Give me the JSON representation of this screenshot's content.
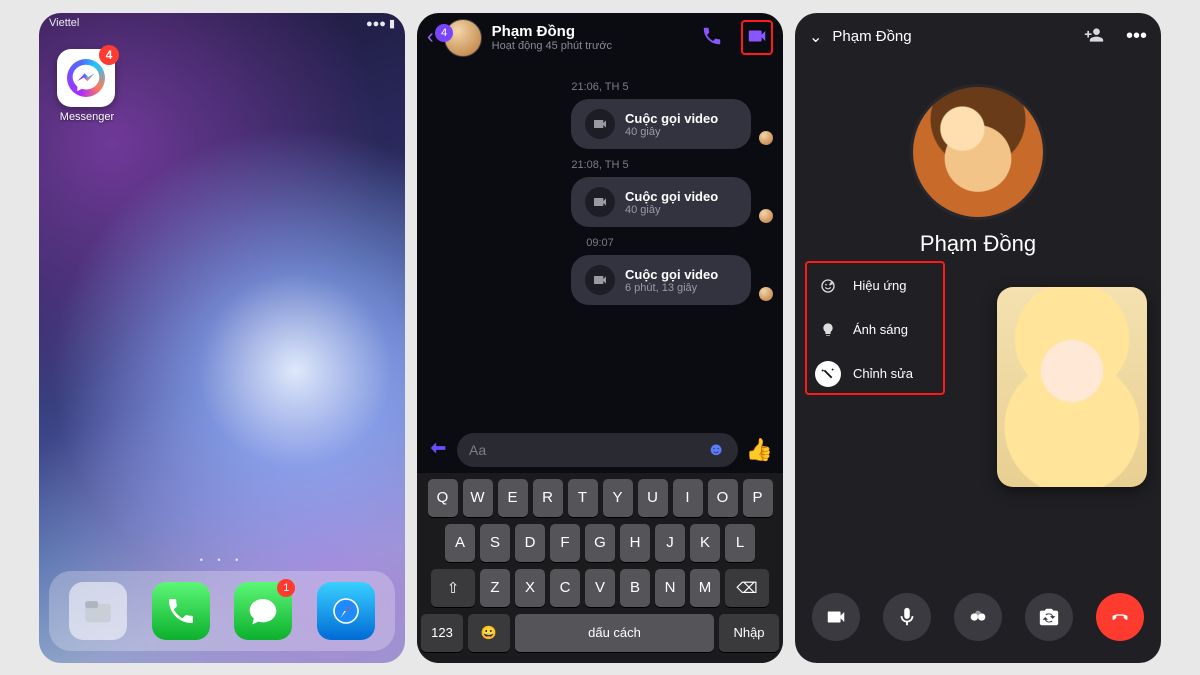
{
  "panel1": {
    "carrier": "Viettel",
    "messenger": {
      "label": "Messenger",
      "badge": "4"
    },
    "page_dots": "• • •",
    "dock": {
      "messages_badge": "1"
    }
  },
  "panel2": {
    "back_badge": "4",
    "name": "Phạm Đồng",
    "status": "Hoạt động 45 phút trước",
    "thread": [
      {
        "ts": "21:06, TH 5",
        "title": "Cuộc gọi video",
        "sub": "40 giây"
      },
      {
        "ts": "21:08, TH 5",
        "title": "Cuộc gọi video",
        "sub": "40 giây"
      },
      {
        "ts": "09:07",
        "title": "Cuộc gọi video",
        "sub": "6 phút, 13 giây"
      }
    ],
    "composer_placeholder": "Aa",
    "keyboard": {
      "row1": [
        "Q",
        "W",
        "E",
        "R",
        "T",
        "Y",
        "U",
        "I",
        "O",
        "P"
      ],
      "row2": [
        "A",
        "S",
        "D",
        "F",
        "G",
        "H",
        "J",
        "K",
        "L"
      ],
      "row3": [
        "⇧",
        "Z",
        "X",
        "C",
        "V",
        "B",
        "N",
        "M",
        "⌫"
      ],
      "row4": [
        "123",
        "😀",
        "dấu cách",
        "Nhập"
      ]
    }
  },
  "panel3": {
    "name": "Phạm Đồng",
    "display_name": "Phạm Đồng",
    "effects": [
      {
        "label": "Hiệu ứng",
        "kind": "face"
      },
      {
        "label": "Ánh sáng",
        "kind": "bulb"
      },
      {
        "label": "Chỉnh sửa",
        "kind": "wand",
        "active": true
      }
    ]
  }
}
